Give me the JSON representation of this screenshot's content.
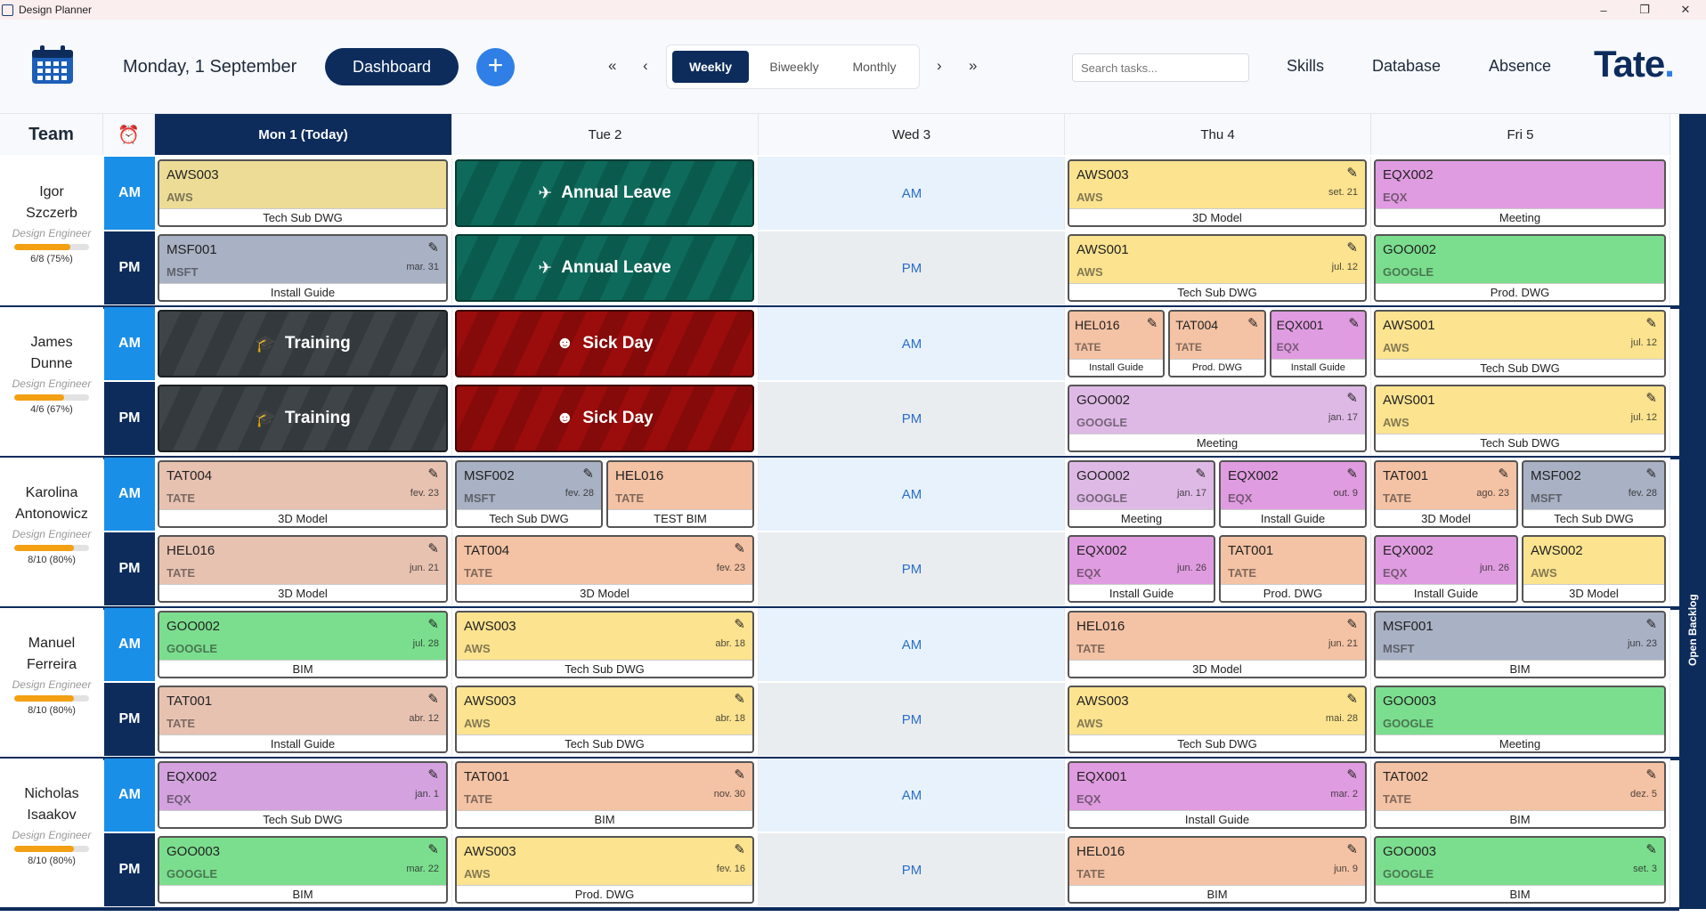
{
  "window": {
    "title": "Design Planner",
    "minimize": "–",
    "maximize": "❐",
    "close": "✕"
  },
  "header": {
    "date": "Monday, 1 September",
    "dashboard": "Dashboard",
    "add": "+",
    "nav": {
      "first": "«",
      "prev": "‹",
      "next": "›",
      "last": "»"
    },
    "views": [
      "Weekly",
      "Biweekly",
      "Monthly"
    ],
    "active_view": "Weekly",
    "search_placeholder": "Search tasks...",
    "links": [
      "Skills",
      "Database",
      "Absence"
    ],
    "logo": "Tate",
    "logo_dot": "."
  },
  "grid": {
    "team_label": "Team",
    "alarm_icon": "⏰",
    "days": [
      "Mon 1 (Today)",
      "Tue 2",
      "Wed 3",
      "Thu 4",
      "Fri 5"
    ],
    "backlog": "Open Backlog",
    "wed_am": "AM",
    "wed_pm": "PM"
  },
  "team": [
    {
      "first": "Igor",
      "last": "Szczerb",
      "role": "Design Engineer",
      "capacity": "6/8 (75%)",
      "progress": 0.75
    },
    {
      "first": "James",
      "last": "Dunne",
      "role": "Design Engineer",
      "capacity": "4/6 (67%)",
      "progress": 0.67
    },
    {
      "first": "Karolina",
      "last": "Antonowicz",
      "role": "Design Engineer",
      "capacity": "8/10 (80%)",
      "progress": 0.8
    },
    {
      "first": "Manuel",
      "last": "Ferreira",
      "role": "Design Engineer",
      "capacity": "8/10 (80%)",
      "progress": 0.8
    },
    {
      "first": "Nicholas",
      "last": "Isaakov",
      "role": "Design Engineer",
      "capacity": "8/10 (80%)",
      "progress": 0.8
    }
  ],
  "slot_labels": {
    "am": "AM",
    "pm": "PM"
  },
  "client_colors": {
    "AWS": "#fbe38f",
    "MSFT": "#a9b1c4",
    "TATE": "#f4c2a4",
    "EQX": "#e09ce0",
    "GOOGLE": "#7bde8e",
    "TATE_LIGHT": "#e8c2b1"
  },
  "absence_labels": {
    "leave": "Annual Leave",
    "sick": "Sick Day",
    "train": "Training"
  },
  "absence_icons": {
    "leave": "✈",
    "sick": "☻",
    "train": "🎓"
  },
  "cards": [
    {
      "m": 0,
      "s": 0,
      "d": 0,
      "code": "AWS003",
      "client": "AWS",
      "task": "Tech Sub DWG",
      "date": "",
      "edit": false,
      "color": "#ecdc96"
    },
    {
      "m": 0,
      "s": 1,
      "d": 0,
      "code": "MSF001",
      "client": "MSFT",
      "task": "Install Guide",
      "date": "mar. 31",
      "edit": true,
      "color": "#a9b1c4"
    },
    {
      "m": 0,
      "s": 0,
      "d": 3,
      "code": "AWS003",
      "client": "AWS",
      "task": "3D Model",
      "date": "set. 21",
      "edit": true,
      "color": "#fbe38f"
    },
    {
      "m": 0,
      "s": 1,
      "d": 3,
      "code": "AWS001",
      "client": "AWS",
      "task": "Tech Sub DWG",
      "date": "jul. 12",
      "edit": true,
      "color": "#fbe38f"
    },
    {
      "m": 0,
      "s": 0,
      "d": 4,
      "code": "EQX002",
      "client": "EQX",
      "task": "Meeting",
      "date": "",
      "edit": false,
      "color": "#e09ce0"
    },
    {
      "m": 0,
      "s": 1,
      "d": 4,
      "code": "GOO002",
      "client": "GOOGLE",
      "task": "Prod. DWG",
      "date": "",
      "edit": false,
      "color": "#7bde8e"
    },
    {
      "m": 1,
      "s": 0,
      "d": 3,
      "sub": 0,
      "of": 3,
      "code": "HEL016",
      "client": "TATE",
      "task": "Install Guide",
      "date": "",
      "edit": true,
      "color": "#f4c2a4"
    },
    {
      "m": 1,
      "s": 0,
      "d": 3,
      "sub": 1,
      "of": 3,
      "code": "TAT004",
      "client": "TATE",
      "task": "Prod. DWG",
      "date": "",
      "edit": true,
      "color": "#f4c2a4"
    },
    {
      "m": 1,
      "s": 0,
      "d": 3,
      "sub": 2,
      "of": 3,
      "code": "EQX001",
      "client": "EQX",
      "task": "Install Guide",
      "date": "",
      "edit": true,
      "color": "#e09ce0"
    },
    {
      "m": 1,
      "s": 1,
      "d": 3,
      "code": "GOO002",
      "client": "GOOGLE",
      "task": "Meeting",
      "date": "jan. 17",
      "edit": true,
      "color": "#dfb9e6"
    },
    {
      "m": 1,
      "s": 0,
      "d": 4,
      "code": "AWS001",
      "client": "AWS",
      "task": "Tech Sub DWG",
      "date": "jul. 12",
      "edit": true,
      "color": "#fbe38f"
    },
    {
      "m": 1,
      "s": 1,
      "d": 4,
      "code": "AWS001",
      "client": "AWS",
      "task": "Tech Sub DWG",
      "date": "jul. 12",
      "edit": true,
      "color": "#fbe38f"
    },
    {
      "m": 2,
      "s": 0,
      "d": 0,
      "code": "TAT004",
      "client": "TATE",
      "task": "3D Model",
      "date": "fev. 23",
      "edit": true,
      "color": "#e8c2b1"
    },
    {
      "m": 2,
      "s": 1,
      "d": 0,
      "code": "HEL016",
      "client": "TATE",
      "task": "3D Model",
      "date": "jun. 21",
      "edit": true,
      "color": "#e8c2b1"
    },
    {
      "m": 2,
      "s": 0,
      "d": 1,
      "sub": 0,
      "of": 2,
      "code": "MSF002",
      "client": "MSFT",
      "task": "Tech Sub DWG",
      "date": "fev. 28",
      "edit": true,
      "color": "#a9b1c4"
    },
    {
      "m": 2,
      "s": 0,
      "d": 1,
      "sub": 1,
      "of": 2,
      "code": "HEL016",
      "client": "TATE",
      "task": "TEST BIM",
      "date": "",
      "edit": false,
      "color": "#f4c2a4"
    },
    {
      "m": 2,
      "s": 1,
      "d": 1,
      "code": "TAT004",
      "client": "TATE",
      "task": "3D Model",
      "date": "fev. 23",
      "edit": true,
      "color": "#f4c2a4"
    },
    {
      "m": 2,
      "s": 0,
      "d": 3,
      "sub": 0,
      "of": 2,
      "code": "GOO002",
      "client": "GOOGLE",
      "task": "Meeting",
      "date": "jan. 17",
      "edit": true,
      "color": "#dfb9e6"
    },
    {
      "m": 2,
      "s": 0,
      "d": 3,
      "sub": 1,
      "of": 2,
      "code": "EQX002",
      "client": "EQX",
      "task": "Install Guide",
      "date": "out. 9",
      "edit": true,
      "color": "#e09ce0"
    },
    {
      "m": 2,
      "s": 1,
      "d": 3,
      "sub": 0,
      "of": 2,
      "code": "EQX002",
      "client": "EQX",
      "task": "Install Guide",
      "date": "jun. 26",
      "edit": false,
      "color": "#e09ce0"
    },
    {
      "m": 2,
      "s": 1,
      "d": 3,
      "sub": 1,
      "of": 2,
      "code": "TAT001",
      "client": "TATE",
      "task": "Prod. DWG",
      "date": "",
      "edit": false,
      "color": "#f4c2a4"
    },
    {
      "m": 2,
      "s": 0,
      "d": 4,
      "sub": 0,
      "of": 2,
      "code": "TAT001",
      "client": "TATE",
      "task": "3D Model",
      "date": "ago. 23",
      "edit": true,
      "color": "#f4c2a4"
    },
    {
      "m": 2,
      "s": 0,
      "d": 4,
      "sub": 1,
      "of": 2,
      "code": "MSF002",
      "client": "MSFT",
      "task": "Tech Sub DWG",
      "date": "fev. 28",
      "edit": true,
      "color": "#a9b1c4"
    },
    {
      "m": 2,
      "s": 1,
      "d": 4,
      "sub": 0,
      "of": 2,
      "code": "EQX002",
      "client": "EQX",
      "task": "Install Guide",
      "date": "jun. 26",
      "edit": false,
      "color": "#e09ce0"
    },
    {
      "m": 2,
      "s": 1,
      "d": 4,
      "sub": 1,
      "of": 2,
      "code": "AWS002",
      "client": "AWS",
      "task": "3D Model",
      "date": "",
      "edit": false,
      "color": "#fbe38f"
    },
    {
      "m": 3,
      "s": 0,
      "d": 0,
      "code": "GOO002",
      "client": "GOOGLE",
      "task": "BIM",
      "date": "jul. 28",
      "edit": true,
      "color": "#7bde8e"
    },
    {
      "m": 3,
      "s": 1,
      "d": 0,
      "code": "TAT001",
      "client": "TATE",
      "task": "Install Guide",
      "date": "abr. 12",
      "edit": true,
      "color": "#e8c2b1"
    },
    {
      "m": 3,
      "s": 0,
      "d": 1,
      "code": "AWS003",
      "client": "AWS",
      "task": "Tech Sub DWG",
      "date": "abr. 18",
      "edit": true,
      "color": "#fbe38f"
    },
    {
      "m": 3,
      "s": 1,
      "d": 1,
      "code": "AWS003",
      "client": "AWS",
      "task": "Tech Sub DWG",
      "date": "abr. 18",
      "edit": true,
      "color": "#fbe38f"
    },
    {
      "m": 3,
      "s": 0,
      "d": 3,
      "code": "HEL016",
      "client": "TATE",
      "task": "3D Model",
      "date": "jun. 21",
      "edit": true,
      "color": "#f4c2a4"
    },
    {
      "m": 3,
      "s": 1,
      "d": 3,
      "code": "AWS003",
      "client": "AWS",
      "task": "Tech Sub DWG",
      "date": "mai. 28",
      "edit": true,
      "color": "#fbe38f"
    },
    {
      "m": 3,
      "s": 0,
      "d": 4,
      "code": "MSF001",
      "client": "MSFT",
      "task": "BIM",
      "date": "jun. 23",
      "edit": true,
      "color": "#a9b1c4"
    },
    {
      "m": 3,
      "s": 1,
      "d": 4,
      "code": "GOO003",
      "client": "GOOGLE",
      "task": "Meeting",
      "date": "",
      "edit": false,
      "color": "#7bde8e"
    },
    {
      "m": 4,
      "s": 0,
      "d": 0,
      "code": "EQX002",
      "client": "EQX",
      "task": "Tech Sub DWG",
      "date": "jan. 1",
      "edit": true,
      "color": "#d4a3df"
    },
    {
      "m": 4,
      "s": 1,
      "d": 0,
      "code": "GOO003",
      "client": "GOOGLE",
      "task": "BIM",
      "date": "mar. 22",
      "edit": true,
      "color": "#7bde8e"
    },
    {
      "m": 4,
      "s": 0,
      "d": 1,
      "code": "TAT001",
      "client": "TATE",
      "task": "BIM",
      "date": "nov. 30",
      "edit": true,
      "color": "#f4c2a4"
    },
    {
      "m": 4,
      "s": 1,
      "d": 1,
      "code": "AWS003",
      "client": "AWS",
      "task": "Prod. DWG",
      "date": "fev. 16",
      "edit": true,
      "color": "#fbe38f"
    },
    {
      "m": 4,
      "s": 0,
      "d": 3,
      "code": "EQX001",
      "client": "EQX",
      "task": "Install Guide",
      "date": "mar. 2",
      "edit": true,
      "color": "#e09ce0"
    },
    {
      "m": 4,
      "s": 1,
      "d": 3,
      "code": "HEL016",
      "client": "TATE",
      "task": "BIM",
      "date": "jun. 9",
      "edit": true,
      "color": "#f4c2a4"
    },
    {
      "m": 4,
      "s": 0,
      "d": 4,
      "code": "TAT002",
      "client": "TATE",
      "task": "BIM",
      "date": "dez. 5",
      "edit": true,
      "color": "#f4c2a4"
    },
    {
      "m": 4,
      "s": 1,
      "d": 4,
      "code": "GOO003",
      "client": "GOOGLE",
      "task": "BIM",
      "date": "set. 3",
      "edit": true,
      "color": "#7bde8e"
    }
  ],
  "absences": [
    {
      "m": 0,
      "s": 0,
      "d": 1,
      "type": "leave"
    },
    {
      "m": 0,
      "s": 1,
      "d": 1,
      "type": "leave"
    },
    {
      "m": 1,
      "s": 0,
      "d": 0,
      "type": "train"
    },
    {
      "m": 1,
      "s": 1,
      "d": 0,
      "type": "train"
    },
    {
      "m": 1,
      "s": 0,
      "d": 1,
      "type": "sick"
    },
    {
      "m": 1,
      "s": 1,
      "d": 1,
      "type": "sick"
    }
  ]
}
